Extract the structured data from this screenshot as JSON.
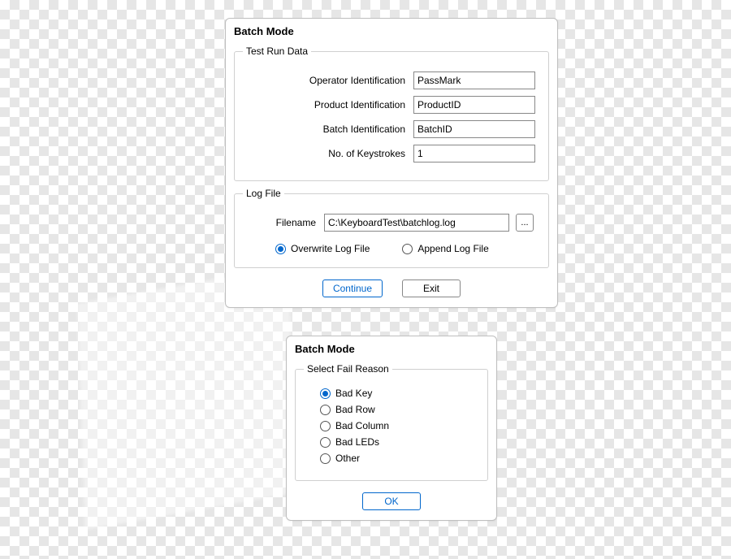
{
  "dialog1": {
    "title": "Batch Mode",
    "testRunData": {
      "legend": "Test Run Data",
      "operator_label": "Operator Identification",
      "operator_value": "PassMark",
      "product_label": "Product Identification",
      "product_value": "ProductID",
      "batch_label": "Batch Identification",
      "batch_value": "BatchID",
      "keystrokes_label": "No. of Keystrokes",
      "keystrokes_value": "1"
    },
    "logFile": {
      "legend": "Log File",
      "filename_label": "Filename",
      "filename_value": "C:\\KeyboardTest\\batchlog.log",
      "browse_label": "...",
      "overwrite_label": "Overwrite Log File",
      "append_label": "Append Log File"
    },
    "buttons": {
      "continue": "Continue",
      "exit": "Exit"
    }
  },
  "dialog2": {
    "title": "Batch Mode",
    "group_legend": "Select Fail Reason",
    "options": {
      "bad_key": "Bad Key",
      "bad_row": "Bad Row",
      "bad_column": "Bad Column",
      "bad_leds": "Bad LEDs",
      "other": "Other"
    },
    "ok": "OK"
  }
}
